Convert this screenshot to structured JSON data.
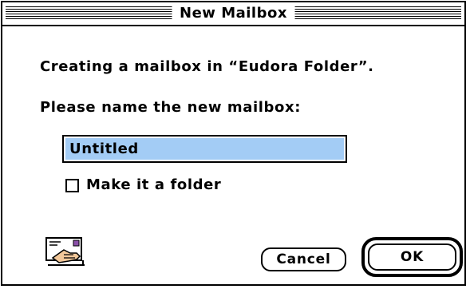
{
  "window": {
    "title": "New Mailbox"
  },
  "dialog": {
    "message": "Creating a mailbox in “Eudora Folder”.",
    "prompt": "Please name the new mailbox:",
    "name_field": {
      "value": "Untitled"
    },
    "folder_checkbox": {
      "label": "Make it a folder",
      "checked": false
    },
    "icon": "envelope-hand-icon"
  },
  "buttons": {
    "cancel_label": "Cancel",
    "ok_label": "OK"
  },
  "colors": {
    "selection_highlight": "#a3ccf5"
  }
}
